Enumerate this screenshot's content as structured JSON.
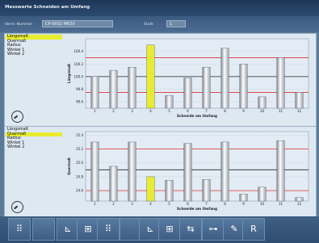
{
  "window": {
    "title": "Messwerte Schneiden am Umfang"
  },
  "fields": {
    "id_label": "Ident.-Nummer",
    "id_value": "CP-0002-MK50",
    "stufe_label": "Stufe",
    "stufe_value": "1"
  },
  "legend_top": [
    "Längsmaß",
    "Quermaß",
    "Radius",
    "Winkel 1",
    "Winkel 2"
  ],
  "legend_bottom": [
    "Längsmaß",
    "Quermaß",
    "Radius",
    "Winkel 1",
    "Winkel 2"
  ],
  "colors": {
    "highlight": "#e8ec30",
    "limit_red": "#e03030",
    "nominal": "#222222"
  },
  "toolbar": {
    "buttons": [
      {
        "icon": "grid-icon",
        "glyph": "⠿"
      },
      {
        "icon": "blank-icon",
        "glyph": ""
      },
      {
        "icon": "axis-icon",
        "glyph": "⊾"
      },
      {
        "icon": "table-icon",
        "glyph": "⊞"
      },
      {
        "icon": "grid-icon",
        "glyph": "⠿"
      },
      {
        "icon": "blank-icon",
        "glyph": ""
      },
      {
        "icon": "axis-icon",
        "glyph": "⊾"
      },
      {
        "icon": "table-icon",
        "glyph": "⊞"
      },
      {
        "icon": "swap-icon",
        "glyph": "⇆"
      },
      {
        "icon": "key-icon",
        "glyph": "⊶"
      },
      {
        "icon": "eraser-icon",
        "glyph": "✎"
      },
      {
        "icon": "r-icon",
        "glyph": "R"
      }
    ]
  },
  "chart_data": [
    {
      "type": "bar",
      "ylabel": "Längsmaß",
      "xlabel": "Schneide am Umfang",
      "categories": [
        "1",
        "2",
        "3",
        "4",
        "5",
        "6",
        "7",
        "8",
        "9",
        "10",
        "11",
        "12"
      ],
      "values": [
        100.0,
        100.1,
        100.15,
        100.5,
        99.7,
        99.98,
        100.15,
        100.45,
        100.2,
        99.68,
        100.3,
        99.75
      ],
      "highlight_index": 3,
      "yticks": [
        99.6,
        99.8,
        100.0,
        100.2,
        100.4
      ],
      "ylim": [
        99.5,
        100.6
      ],
      "limits_red": [
        99.75,
        100.3
      ],
      "nominal": 100.0
    },
    {
      "type": "bar",
      "ylabel": "Quermaß",
      "xlabel": "Schneide am Umfang",
      "categories": [
        "1",
        "2",
        "3",
        "4",
        "5",
        "6",
        "7",
        "8",
        "9",
        "10",
        "11",
        "12"
      ],
      "values": [
        25.3,
        24.95,
        25.3,
        24.8,
        24.75,
        25.28,
        24.76,
        25.3,
        24.55,
        24.65,
        25.32,
        24.5
      ],
      "highlight_index": 3,
      "yticks": [
        24.6,
        24.8,
        25.0,
        25.2,
        25.4
      ],
      "ylim": [
        24.45,
        25.45
      ],
      "limits_red": [
        24.6,
        25.2
      ],
      "nominal": 24.9
    }
  ]
}
